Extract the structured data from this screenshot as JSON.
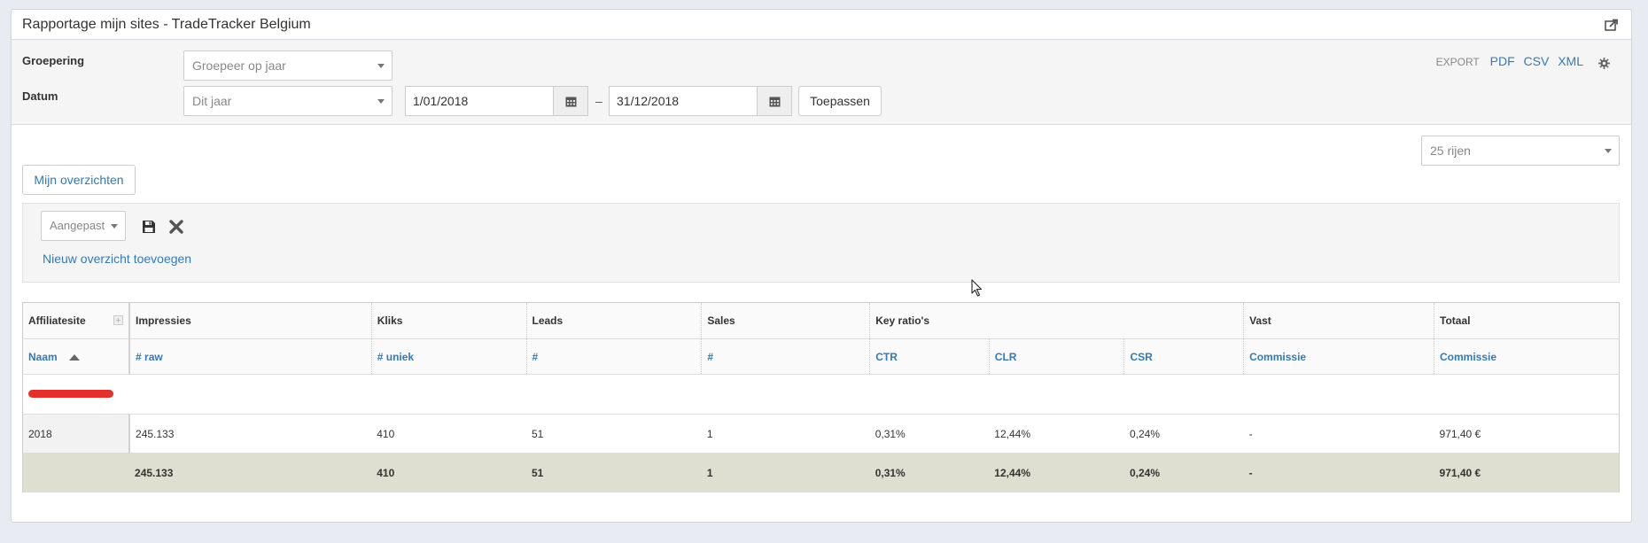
{
  "panel": {
    "title": "Rapportage mijn sites - TradeTracker Belgium"
  },
  "filters": {
    "grouping_label": "Groepering",
    "grouping_value": "Groepeer op jaar",
    "date_label": "Datum",
    "date_range_value": "Dit jaar",
    "date_from": "1/01/2018",
    "date_separator": "–",
    "date_to": "31/12/2018",
    "apply_label": "Toepassen"
  },
  "export": {
    "label": "EXPORT",
    "pdf": "PDF",
    "csv": "CSV",
    "xml": "XML"
  },
  "rows_select": "25 rijen",
  "my_overviews_label": "Mijn overzichten",
  "overview": {
    "custom_select": "Aangepast",
    "new_link": "Nieuw overzicht toevoegen"
  },
  "table": {
    "group_headers": [
      "Affiliatesite",
      "Impressies",
      "Kliks",
      "Leads",
      "Sales",
      "Key ratio's",
      "Vast",
      "Totaal"
    ],
    "sub_headers": [
      "Naam",
      "# raw",
      "# uniek",
      "#",
      "#",
      "CTR",
      "CLR",
      "CSR",
      "Commissie",
      "Commissie"
    ],
    "rows": [
      {
        "name": "2018",
        "impr": "245.133",
        "clicks": "410",
        "leads": "51",
        "sales": "1",
        "ctr": "0,31%",
        "clr": "12,44%",
        "csr": "0,24%",
        "vast": "-",
        "total": "971,40 €"
      }
    ],
    "totals": {
      "impr": "245.133",
      "clicks": "410",
      "leads": "51",
      "sales": "1",
      "ctr": "0,31%",
      "clr": "12,44%",
      "csr": "0,24%",
      "vast": "-",
      "total": "971,40 €"
    }
  },
  "colors": {
    "link": "#337ab7",
    "total_row_bg": "#dedfd0",
    "redaction": "#e4302d"
  },
  "icons": [
    "share-icon",
    "calendar-icon",
    "gear-icon",
    "caret-down-icon",
    "save-icon",
    "close-icon",
    "plus-icon",
    "sort-asc-icon",
    "mouse-cursor-icon"
  ]
}
